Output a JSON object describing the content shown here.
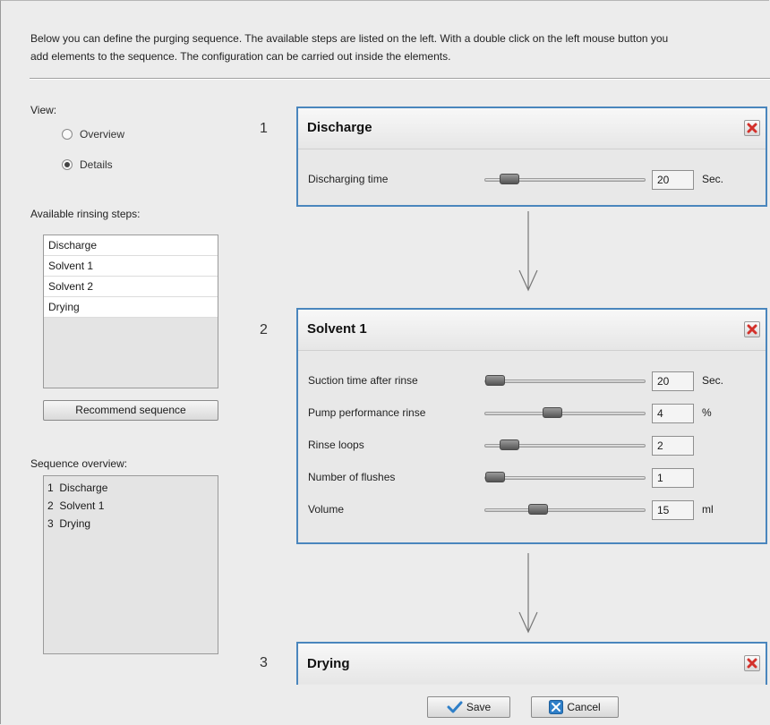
{
  "intro": {
    "line1": "Below you can define the purging sequence. The available steps are listed on the left. With a double click on the left mouse button you",
    "line2": "add elements to the sequence. The configuration can be carried out inside the elements."
  },
  "view": {
    "label": "View:",
    "options": [
      {
        "label": "Overview",
        "selected": false
      },
      {
        "label": "Details",
        "selected": true
      }
    ]
  },
  "available": {
    "label": "Available rinsing steps:",
    "items": [
      "Discharge",
      "Solvent 1",
      "Solvent 2",
      "Drying"
    ]
  },
  "recommend_label": "Recommend sequence",
  "sequence": {
    "label": "Sequence overview:",
    "items": [
      {
        "num": "1",
        "name": "Discharge"
      },
      {
        "num": "2",
        "name": "Solvent 1"
      },
      {
        "num": "3",
        "name": "Drying"
      }
    ]
  },
  "cards": [
    {
      "num": "1",
      "title": "Discharge",
      "params": [
        {
          "label": "Discharging time",
          "value": "20",
          "unit": "Sec.",
          "level": 0.15
        }
      ]
    },
    {
      "num": "2",
      "title": "Solvent 1",
      "params": [
        {
          "label": "Suction time after rinse",
          "value": "20",
          "unit": "Sec.",
          "level": 0.06
        },
        {
          "label": "Pump performance rinse",
          "value": "4",
          "unit": "%",
          "level": 0.42
        },
        {
          "label": "Rinse loops",
          "value": "2",
          "unit": "",
          "level": 0.15
        },
        {
          "label": "Number of flushes",
          "value": "1",
          "unit": "",
          "level": 0.06
        },
        {
          "label": "Volume",
          "value": "15",
          "unit": "ml",
          "level": 0.33
        }
      ]
    },
    {
      "num": "3",
      "title": "Drying",
      "params": []
    }
  ],
  "footer": {
    "save_label": "Save",
    "cancel_label": "Cancel"
  },
  "colors": {
    "card_border": "#4a86bd",
    "close_x": "#d3312b",
    "save_check": "#2f7fc8",
    "cancel_box": "#2f7fc8"
  }
}
